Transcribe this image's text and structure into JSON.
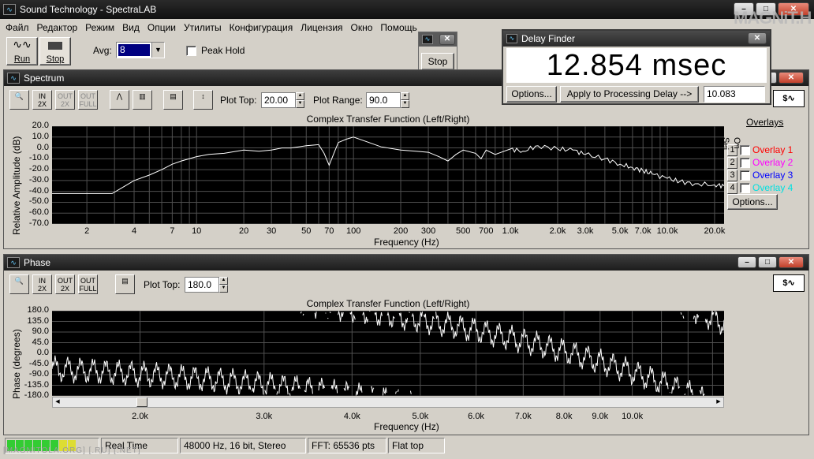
{
  "app": {
    "title": "Sound Technology - SpectraLAB"
  },
  "brand_watermark": "MAGNiT.H",
  "menu": [
    "Файл",
    "Редактор",
    "Режим",
    "Вид",
    "Опции",
    "Утилиты",
    "Конфигурация",
    "Лицензия",
    "Окно",
    "Помощь"
  ],
  "toolbar": {
    "run_label": "Run",
    "stop_label": "Stop",
    "avg_label": "Avg:",
    "avg_value": "8",
    "peak_hold_label": "Peak Hold"
  },
  "stop_window": {
    "stop_label": "Stop"
  },
  "delay_finder": {
    "title": "Delay Finder",
    "value": "12.854 msec",
    "options_label": "Options...",
    "apply_label": "Apply to Processing Delay -->",
    "processing_delay": "10.083"
  },
  "spectrum": {
    "title": "Spectrum",
    "plot_top_label": "Plot Top:",
    "plot_top": "20.00",
    "plot_range_label": "Plot Range:",
    "plot_range": "90.0",
    "chart_title": "Complex Transfer Function (Left/Right)",
    "ylabel": "Relative Amplitude (dB)",
    "xlabel": "Frequency (Hz)",
    "yticks": [
      "20.0",
      "10.0",
      "0.0",
      "-10.0",
      "-20.0",
      "-30.0",
      "-40.0",
      "-50.0",
      "-60.0",
      "-70.0"
    ],
    "xticks": [
      "2",
      "4",
      "7",
      "10",
      "20",
      "30",
      "50",
      "70",
      "100",
      "200",
      "300",
      "500",
      "700",
      "1.0k",
      "2.0k",
      "3.0k",
      "5.0k",
      "7.0k",
      "10.0k",
      "20.0k"
    ],
    "overlays_title": "Overlays",
    "set_label": "Set",
    "on_label": "On",
    "overlays": [
      {
        "num": "1",
        "label": "Overlay 1",
        "color": "#ff0000"
      },
      {
        "num": "2",
        "label": "Overlay 2",
        "color": "#ff00ff"
      },
      {
        "num": "3",
        "label": "Overlay 3",
        "color": "#0000ff"
      },
      {
        "num": "4",
        "label": "Overlay 4",
        "color": "#00e0e0"
      }
    ],
    "options_label": "Options..."
  },
  "phase": {
    "title": "Phase",
    "plot_top_label": "Plot Top:",
    "plot_top": "180.0",
    "chart_title": "Complex Transfer Function (Left/Right)",
    "ylabel": "Phase (degrees)",
    "xlabel": "Frequency (Hz)",
    "yticks": [
      "180.0",
      "135.0",
      "90.0",
      "45.0",
      "0.0",
      "-45.0",
      "-90.0",
      "-135.0",
      "-180.0"
    ],
    "xticks": [
      "2.0k",
      "3.0k",
      "4.0k",
      "5.0k",
      "6.0k",
      "7.0k",
      "8.0k",
      "9.0k",
      "10.0k"
    ]
  },
  "status": {
    "mode": "Real Time",
    "format": "48000 Hz, 16 bit, Stereo",
    "fft": "FFT: 65536 pts",
    "window": "Flat top"
  },
  "footer_watermark": "[MAGNITOLA.ORG] [.RU] [.NET]",
  "colors": {
    "trace": "#ffffff",
    "plot_bg": "#000000",
    "grid": "#505050",
    "titlebar": "#1c1c1c"
  },
  "chart_data": [
    {
      "type": "line",
      "title": "Complex Transfer Function (Left/Right)",
      "xlabel": "Frequency (Hz)",
      "ylabel": "Relative Amplitude (dB)",
      "xscale": "log",
      "xlim": [
        1.2,
        23000
      ],
      "ylim": [
        -70,
        20
      ],
      "grid": true,
      "series": [
        {
          "x": [
            1.2,
            2,
            2.9,
            3.5,
            4,
            5,
            6,
            7,
            8,
            10,
            12,
            15,
            20,
            25,
            30,
            35,
            40,
            50,
            60,
            65,
            70,
            75,
            80,
            90,
            100,
            120,
            150,
            200,
            250,
            300,
            350,
            400,
            450,
            500,
            600,
            650,
            700,
            800,
            1000,
            1200,
            1500,
            2000,
            2500,
            3000,
            4000,
            5000,
            6000,
            7000,
            8000,
            10000,
            12000,
            15000,
            20000,
            23000
          ],
          "y": [
            -42,
            -42,
            -42,
            -35,
            -30,
            -25,
            -20,
            -15,
            -12,
            -8,
            -6,
            -5,
            -2,
            -3,
            -2,
            0,
            0,
            2,
            3,
            -5,
            -16,
            -5,
            5,
            8,
            10,
            6,
            1,
            -2,
            -3,
            -4,
            -8,
            -12,
            -6,
            -2,
            -5,
            -10,
            -2,
            -6,
            -1,
            -3,
            2,
            -1,
            -2,
            -6,
            -10,
            -15,
            -18,
            -21,
            -24,
            -28,
            -31,
            -33,
            -34,
            -35
          ]
        }
      ]
    },
    {
      "type": "line",
      "title": "Complex Transfer Function (Left/Right)",
      "xlabel": "Frequency (Hz)",
      "ylabel": "Phase (degrees)",
      "xscale": "log",
      "xlim": [
        1500,
        13500
      ],
      "ylim": [
        -180,
        180
      ],
      "grid": true,
      "series": [
        {
          "note_style": "wrapped phase",
          "x": [
            1500,
            1700,
            1800,
            1900,
            2000,
            2200,
            2500,
            2800
          ],
          "y": [
            -30,
            -110,
            -60,
            -170,
            175,
            60,
            -20,
            -140
          ]
        }
      ]
    }
  ]
}
